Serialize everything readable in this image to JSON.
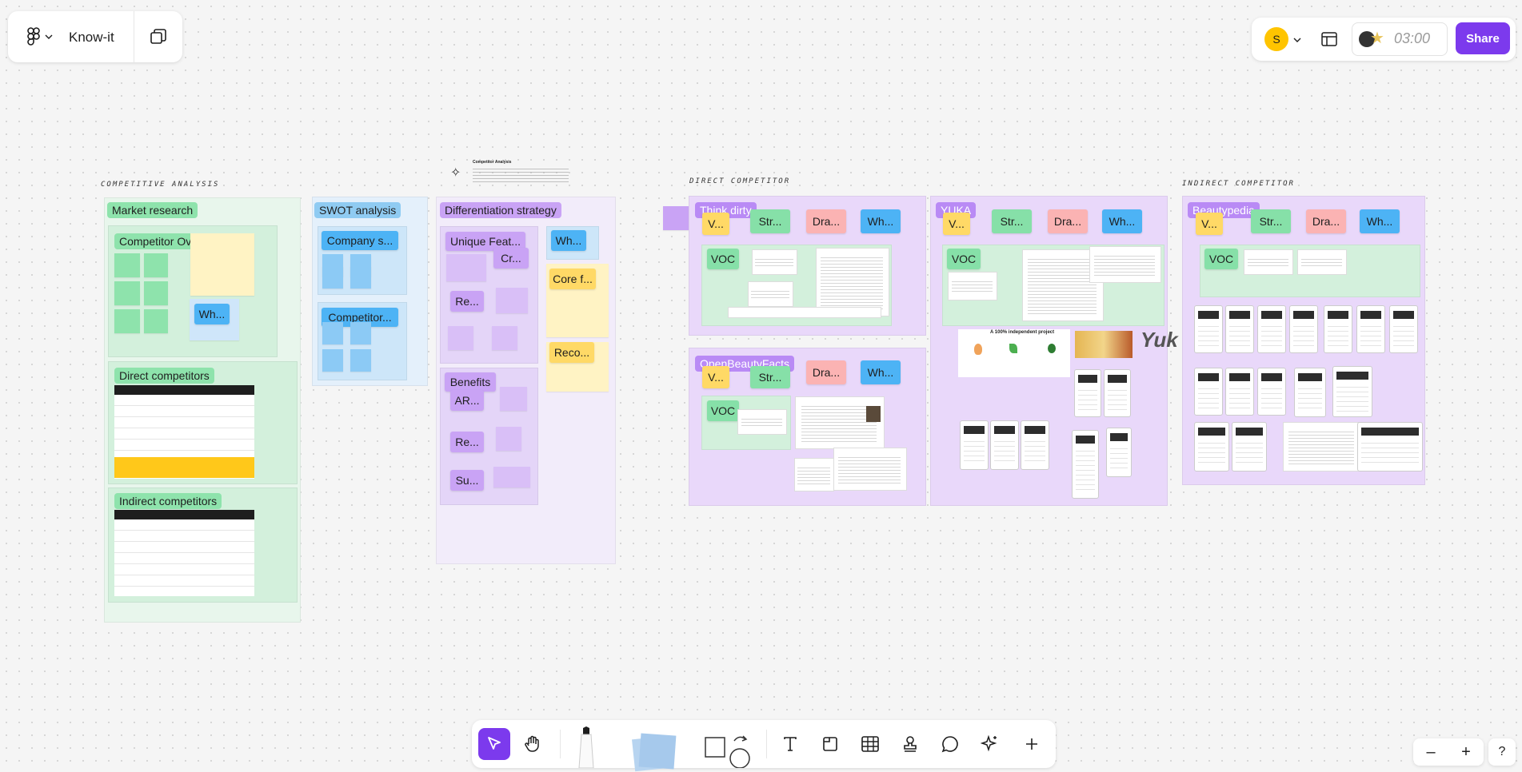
{
  "app": {
    "file_name": "Know-it",
    "avatar_initial": "S",
    "timer": "03:00",
    "share_label": "Share"
  },
  "sections": {
    "competitive_analysis": "COMPETITIVE ANALYSIS",
    "direct_competitor": "DIRECT COMPETITOR",
    "indirect_competitor": "INDIRECT COMPETITOR",
    "competitor_analysis_title": "Competitor Analysis"
  },
  "market": {
    "title": "Market research",
    "competitor_overview": "Competitor Overview",
    "direct_competitors": "Direct competitors",
    "indirect_competitors": "Indirect competitors",
    "wh": "Wh..."
  },
  "swot": {
    "title": "SWOT analysis",
    "company": "Company s...",
    "competitor": "Competitor..."
  },
  "diff": {
    "title": "Differentiation strategy",
    "unique": "Unique Feat...",
    "cr": "Cr...",
    "wh": "Wh...",
    "re1": "Re...",
    "core": "Core f...",
    "benefits": "Benefits",
    "ar": "AR...",
    "re2": "Re...",
    "su": "Su...",
    "reco": "Reco..."
  },
  "competitors": [
    {
      "name": "Think dirty",
      "stickies": [
        "V...",
        "Str...",
        "Dra...",
        "Wh..."
      ],
      "voc": "VOC"
    },
    {
      "name": "YUKA",
      "stickies": [
        "V...",
        "Str...",
        "Dra...",
        "Wh..."
      ],
      "voc": "VOC"
    },
    {
      "name": "Beautypedia",
      "stickies": [
        "V...",
        "Str...",
        "Dra...",
        "Wh..."
      ],
      "voc": "VOC"
    },
    {
      "name": "OpenBeautyFacts",
      "stickies": [
        "V...",
        "Str...",
        "Dra...",
        "Wh..."
      ],
      "voc": "VOC"
    }
  ],
  "yuka_extra": {
    "project_caption": "A 100% independent project",
    "logo_text": "Yuk"
  },
  "zoom": {
    "out": "–",
    "in": "+",
    "help": "?"
  },
  "colors": {
    "accent": "#7c3aed",
    "green_sticky": "#86e0a8",
    "blue_sticky": "#4db3f5",
    "yellow_sticky": "#ffd966",
    "pink_sticky": "#fbb3b3",
    "purple_sticky": "#c9a3f5"
  }
}
